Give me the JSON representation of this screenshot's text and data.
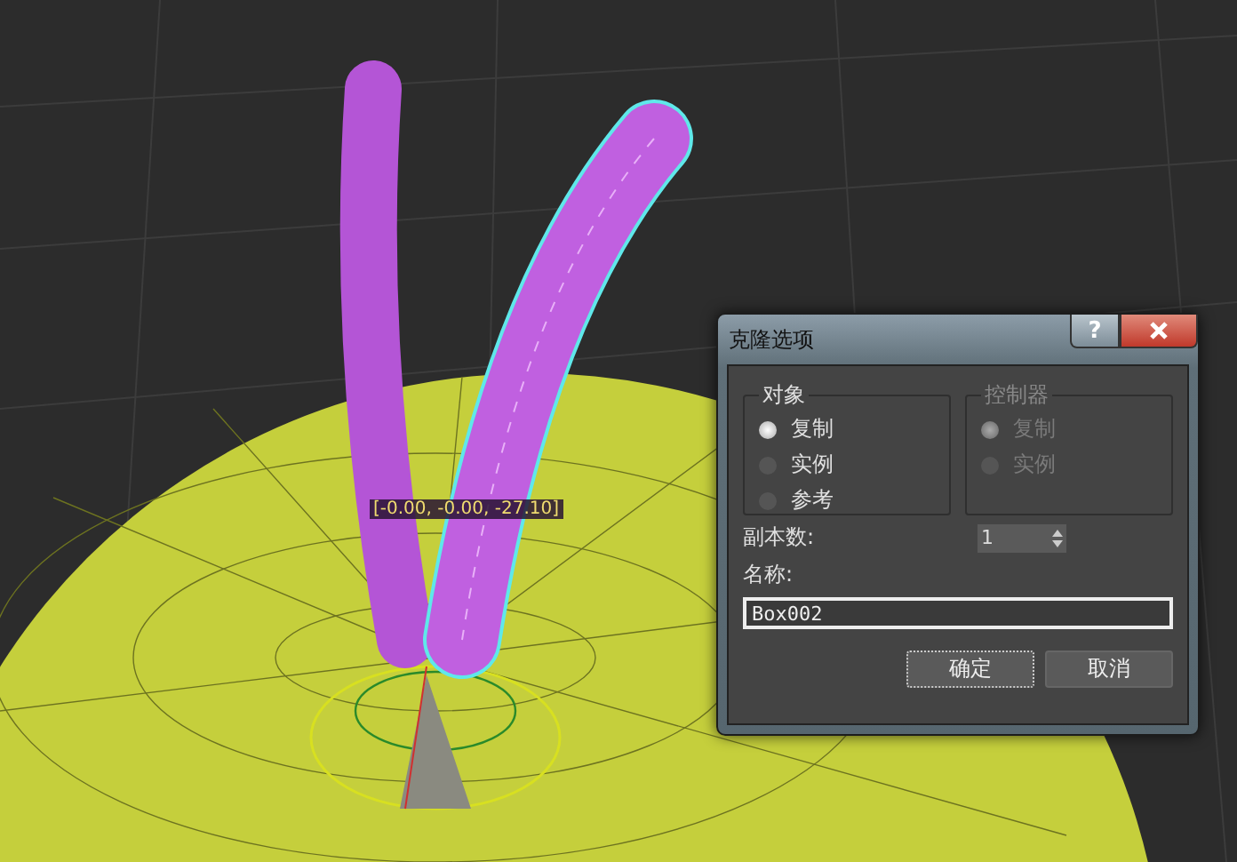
{
  "viewport": {
    "coordinate_readout": "[-0.00, -0.00, -27.10]"
  },
  "dialog": {
    "title": "克隆选项",
    "help_button": "?",
    "groups": [
      {
        "label": "对象",
        "disabled": false,
        "options": [
          {
            "label": "复制",
            "selected": true
          },
          {
            "label": "实例",
            "selected": false
          },
          {
            "label": "参考",
            "selected": false
          }
        ]
      },
      {
        "label": "控制器",
        "disabled": true,
        "options": [
          {
            "label": "复制",
            "selected": true
          },
          {
            "label": "实例",
            "selected": false
          }
        ]
      }
    ],
    "copies": {
      "label": "副本数:",
      "value": "1"
    },
    "name": {
      "label": "名称:",
      "value": "Box002"
    },
    "buttons": [
      {
        "label": "确定",
        "focused": true
      },
      {
        "label": "取消",
        "focused": false
      }
    ]
  }
}
